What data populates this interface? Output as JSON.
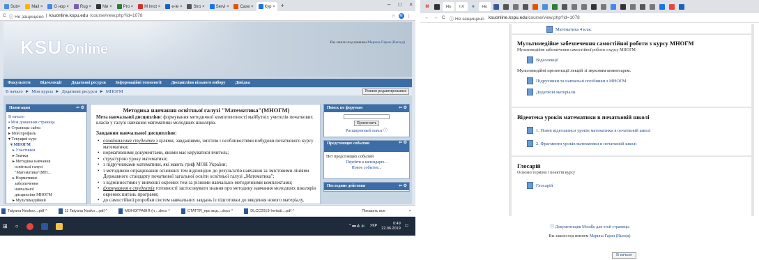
{
  "left": {
    "tabs": [
      {
        "label": "Sub×",
        "color": "#4a90d9"
      },
      {
        "label": "Mail ×",
        "color": "#ffb300"
      },
      {
        "label": "G нор ×",
        "color": "#4285f4"
      },
      {
        "label": "Rug ×",
        "color": "#7b5bb5"
      },
      {
        "label": "Ми ×",
        "color": "#333333"
      },
      {
        "label": "Pro ×",
        "color": "#2e7d32"
      },
      {
        "label": "M Imct ×",
        "color": "#d93025"
      },
      {
        "label": "e-le ×",
        "color": "#1565c0"
      },
      {
        "label": "Stro ×",
        "color": "#555555"
      },
      {
        "label": "Servi ×",
        "color": "#1a73e8"
      },
      {
        "label": "Case ×",
        "color": "#e65100"
      },
      {
        "label": "Кур ×",
        "color": "#1a73e8",
        "active": true
      }
    ],
    "new_tab": "+",
    "window_buttons": [
      "–",
      "□",
      "×"
    ],
    "address": {
      "insecure": "ⓘ Не защищено",
      "sep": " | ",
      "host": "ksuonline.kspu.edu",
      "path": "/course/view.php?id=1078"
    },
    "logo": {
      "ksu": "KSU",
      "online": "Online"
    },
    "login": {
      "prefix": "Вы зашли под именем",
      "user": "Марина Гаран (Выход)"
    },
    "menu": [
      "Факультети",
      "Відеолекції",
      "Додаткові ресурси",
      "Інформаційні технології",
      "Дисципліни вільного вибору",
      "Довідка"
    ],
    "breadcrumb": [
      "В начало",
      "Мои курсы",
      "Додаткові ресурси",
      "МНОГМ"
    ],
    "edit_button": "Режим редактирования",
    "nav_block": {
      "title": "Навигация",
      "items": [
        "В начало",
        "▪ Моя домашняя страница",
        "▸ Страницы сайта",
        "▸ Мой профиль",
        "▾ Текущий курс",
        "  ▾ МНОГМ",
        "    ▸ Участники",
        "    ▸ Значки",
        "    ▸ Методика навчання",
        "      освітньої галузі",
        "      \"Математика\"(МН...",
        "    ▸ Нормативне",
        "      забезпечення",
        "      навчальної",
        "      дисципліни МНОГМ",
        "    ▸ Мультимедійний",
        "      методичний"
      ]
    },
    "content": {
      "title": "Методика навчання освітньої галузі \"Математика\"(МНОГМ)",
      "goal_label": "Мета навчальної дисципліни",
      "goal_text": ": формування методичної компетентності майбутніх учителів початкових класів у галузі навчання математики молодших школярів.",
      "tasks_title": "Завдання навчальної дисципліни:",
      "tasks": [
        {
          "em": "ознайомлення студентів з",
          "rest": " цілями, завданнями, змістом і особливостями побудови початкового курсу математики;"
        },
        {
          "em": "",
          "rest": "нормативними документами, якими має керуватися вчитель;"
        },
        {
          "em": "",
          "rest": "структурою уроку математики;"
        },
        {
          "em": "",
          "rest": "з підручниками математики, які мають гриф МОН України;"
        },
        {
          "em": "",
          "rest": "з методикою опрацювання основних тем відповідно до результатів навчання за змістовими лініями Державного стандарту початкової загальної освіти освітньої галузі „Математика\";"
        },
        {
          "em": "",
          "rest": "з відмінностями у вивченні окремих тем за різними навчально-методичними комплектами;"
        },
        {
          "em": "формування в студентів",
          "rest": " готовності застосовувати знання про методику навчання молодших школярів окремих питань програми;"
        },
        {
          "em": "",
          "rest": "до самостійної розробки систем навчальних завдань із підготовки до введення нового матеріалу, ознайомлення з ним та формування математичних понять та"
        }
      ]
    },
    "forum_block": {
      "title": "Поиск по форумам",
      "button": "Применить",
      "advanced": "Расширенный поиск ⓘ"
    },
    "events_block": {
      "title": "Предстоящие события",
      "none": "Нет предстоящих событий",
      "calendar": "Перейти к календарю...",
      "new_event": "Новое событие..."
    },
    "recent_block": {
      "title": "Последние действия"
    },
    "downloads": [
      {
        "name": "Tatyana Noskov....pdf ^"
      },
      {
        "name": "11 Tatyana Nosko....pdf ^"
      },
      {
        "name": "МОНОГРАФІЯ (н....docx ^"
      },
      {
        "name": "СТАТТЯ_про вид....docx ^"
      },
      {
        "name": "DLCC2019-Invitati....pdf ^"
      }
    ],
    "show_all": "Показать все",
    "tray": {
      "lang": "УКР",
      "time": "0:49",
      "date": "22.06.2019"
    }
  },
  "right": {
    "address": {
      "insecure": "ⓘ Не защищено",
      "sep": " | ",
      "host": "ksuonline.kspu.edu",
      "path": "/course/view.php?id=1078"
    },
    "top_item": "Математика 4 клас",
    "sections": [
      {
        "title": "Мультимедійне забезпечення самостійної роботи з курсу МНОГМ",
        "summary": "Мультимедійне забезпечення самостійної роботи з курсу МНОГМ",
        "items": [
          "Відеолекції"
        ],
        "note": "Мультимедійні  презентації лекцій зі звуковим коментарем.",
        "items2": [
          "Підручники та навчальні посібники з МНОГМ",
          "Додаткові матеріали."
        ]
      },
      {
        "title": "Відеотека уроків математики в початковій школі",
        "items": [
          "1. Повні відеозаписи уроків математики в початковій школі",
          "2. Фрагменти уроків математики в початковій школі"
        ]
      },
      {
        "title": "Глосарій",
        "summary": "Основні терміни і поняття курсу",
        "items": [
          "Глосарій"
        ]
      }
    ],
    "docs_link": "ⓘ Документация Moodle для этой страницы",
    "login": {
      "prefix": "Вы зашли под именем",
      "user": "Марина Гаран (Выход)"
    },
    "home_button": "В начало"
  }
}
